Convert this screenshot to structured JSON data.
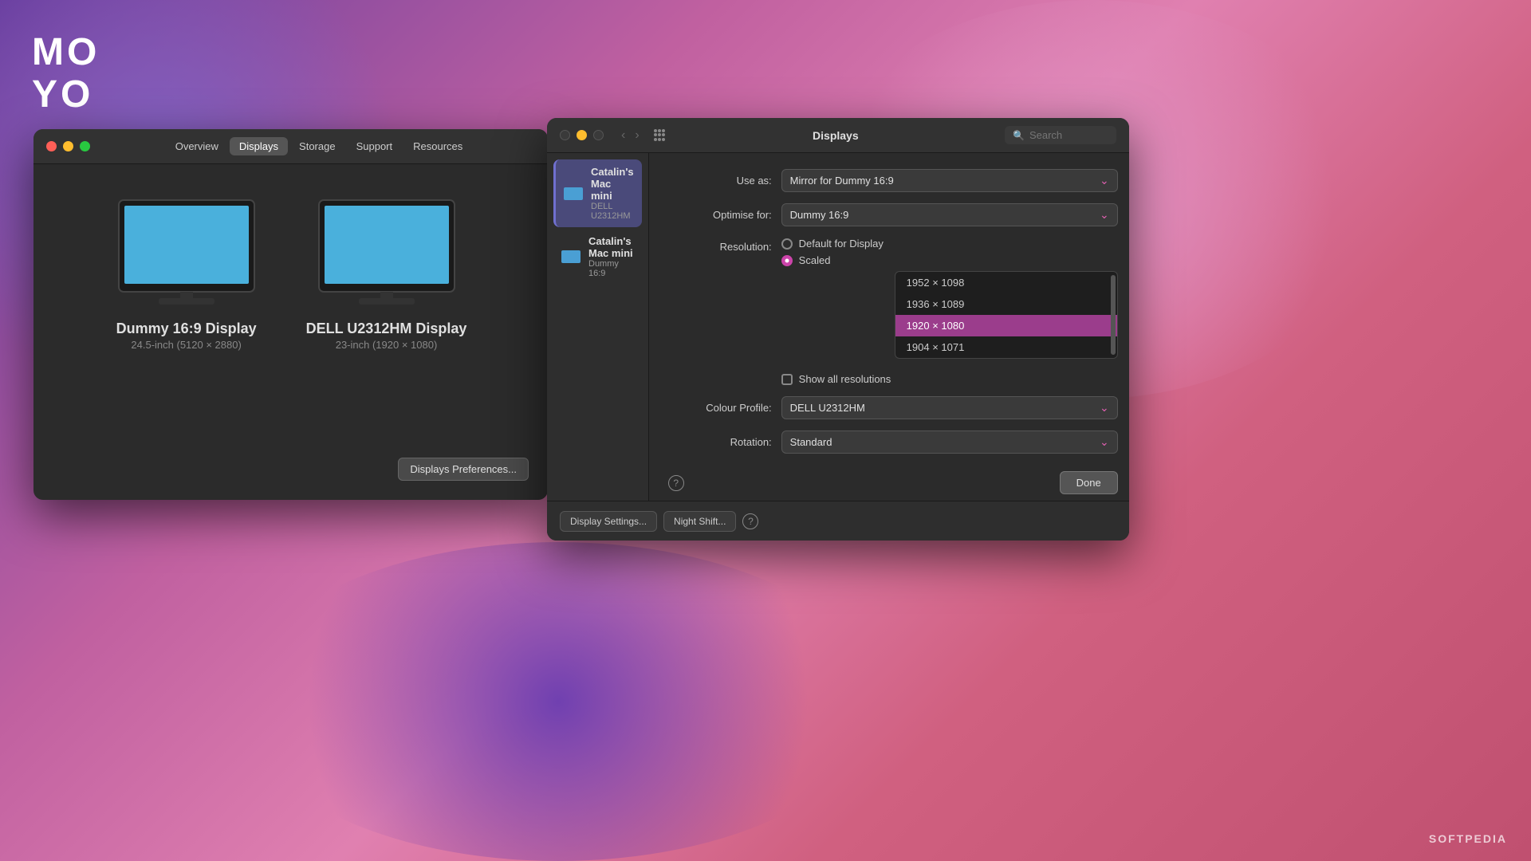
{
  "background": {
    "gradient": "linear-gradient(135deg, #6a3fa0 0%, #c060a0 30%, #e080b0 50%, #d06080 70%, #c05070 100%)"
  },
  "logo": {
    "line1": "MO",
    "line2": "YO"
  },
  "softpedia": "SOFTPEDIA",
  "left_window": {
    "tabs": [
      "Overview",
      "Displays",
      "Storage",
      "Support",
      "Resources"
    ],
    "active_tab": "Displays",
    "displays": [
      {
        "name": "Dummy 16:9 Display",
        "spec": "24.5-inch (5120 × 2880)"
      },
      {
        "name": "DELL U2312HM Display",
        "spec": "23-inch (1920 × 1080)"
      }
    ],
    "prefs_button": "Displays Preferences..."
  },
  "right_window": {
    "title": "Displays",
    "search_placeholder": "Search",
    "sidebar": {
      "items": [
        {
          "name": "Catalin's Mac mini",
          "model": "DELL U2312HM",
          "selected": true
        },
        {
          "name": "Catalin's Mac mini",
          "model": "Dummy 16:9",
          "selected": false
        }
      ]
    },
    "settings": {
      "use_as_label": "Use as:",
      "use_as_value": "Mirror for Dummy 16:9",
      "optimise_for_label": "Optimise for:",
      "optimise_for_value": "Dummy 16:9",
      "resolution_label": "Resolution:",
      "resolution_option1": "Default for Display",
      "resolution_option2": "Scaled",
      "resolutions": [
        {
          "value": "1952 × 1098",
          "highlighted": false
        },
        {
          "value": "1936 × 1089",
          "highlighted": false
        },
        {
          "value": "1920 × 1080",
          "highlighted": true
        },
        {
          "value": "1904 × 1071",
          "highlighted": false
        }
      ],
      "show_all_label": "Show all resolutions",
      "colour_profile_label": "Colour Profile:",
      "colour_profile_value": "DELL U2312HM",
      "rotation_label": "Rotation:",
      "rotation_value": "Standard"
    },
    "bottom": {
      "display_settings_btn": "Display Settings...",
      "night_shift_btn": "Night Shift...",
      "done_btn": "Done"
    }
  }
}
